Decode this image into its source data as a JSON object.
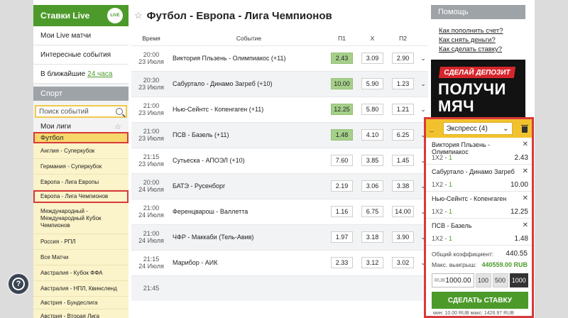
{
  "sidebar": {
    "live_title": "Ставки Live",
    "live_logo_text": "LIVE",
    "links": [
      "Мои Live матчи",
      "Интересные события"
    ],
    "soon_prefix": "В ближайшие",
    "soon_link": "24 часа",
    "sport_title": "Спорт",
    "search_placeholder": "Поиск событий",
    "my_leagues": "Мои лиги",
    "football": "Футбол",
    "leagues": [
      "Англия - Суперкубок",
      "Германия - Суперкубок",
      "Европа - Лига Европы",
      "Европа - Лига Чемпионов",
      "Международный - Международный Кубок Чемпионов",
      "Россия - РПЛ",
      "Все Матчи",
      "Австралия - Кубок ФФА",
      "Австралия - НПЛ, Квинсленд",
      "Австрия - Бундеслига",
      "Австрия - Вторая Лига"
    ]
  },
  "main": {
    "title": "Футбол - Европа - Лига Чемпионов",
    "columns": {
      "time": "Время",
      "event": "Событие",
      "p1": "П1",
      "x": "X",
      "p2": "П2"
    },
    "events": [
      {
        "time": "20:00",
        "date": "23 Июля",
        "name": "Виктория Пльзень - Олимпиакос (+11)",
        "p1": "2.43",
        "x": "3.09",
        "p2": "2.90",
        "sel": "p1"
      },
      {
        "time": "20:30",
        "date": "23 Июля",
        "name": "Сабуртало - Динамо Загреб (+10)",
        "p1": "10.00",
        "x": "5.90",
        "p2": "1.23",
        "sel": "p1"
      },
      {
        "time": "21:00",
        "date": "23 Июля",
        "name": "Нью-Сейнтс - Копенгаген (+11)",
        "p1": "12.25",
        "x": "5.80",
        "p2": "1.21",
        "sel": "p1"
      },
      {
        "time": "21:00",
        "date": "23 Июля",
        "name": "ПСВ - Базель (+11)",
        "p1": "1.48",
        "x": "4.10",
        "p2": "6.25",
        "sel": "p1"
      },
      {
        "time": "21:15",
        "date": "23 Июля",
        "name": "Сутьеска - АПОЭЛ (+10)",
        "p1": "7.60",
        "x": "3.85",
        "p2": "1.45",
        "sel": ""
      },
      {
        "time": "20:00",
        "date": "24 Июля",
        "name": "БАТЭ - Русенборг",
        "p1": "2.19",
        "x": "3.06",
        "p2": "3.38",
        "sel": ""
      },
      {
        "time": "21:00",
        "date": "24 Июля",
        "name": "Ференцварош - Валлетта",
        "p1": "1.16",
        "x": "6.75",
        "p2": "14.00",
        "sel": ""
      },
      {
        "time": "21:00",
        "date": "24 Июля",
        "name": "ЧФР - Маккаби (Тель-Авив)",
        "p1": "1.97",
        "x": "3.18",
        "p2": "3.90",
        "sel": ""
      },
      {
        "time": "21:15",
        "date": "24 Июля",
        "name": "Марибор - АИК",
        "p1": "2.33",
        "x": "3.12",
        "p2": "3.02",
        "sel": ""
      },
      {
        "time": "21:45",
        "date": "",
        "name": "",
        "p1": "",
        "x": "",
        "p2": "",
        "sel": ""
      }
    ]
  },
  "help": {
    "title": "Помощь",
    "links": [
      "Как пополнить счет?",
      "Как снять деньги?",
      "Как сделать ставку?"
    ]
  },
  "banner": {
    "band": "СДЕЛАЙ ДЕПОЗИТ",
    "line1": "ПОЛУЧИ",
    "line2": "МЯЧ"
  },
  "coupon": {
    "minimize": "_",
    "type": "Экспресс (4)",
    "bets": [
      {
        "name": "Виктория Пльзень - Олимпиакос",
        "mark_prefix": "1X2 - ",
        "mark": "1",
        "odd": "2.43"
      },
      {
        "name": "Сабуртало - Динамо Загреб",
        "mark_prefix": "1X2 - ",
        "mark": "1",
        "odd": "10.00"
      },
      {
        "name": "Нью-Сейнтс - Копенгаген",
        "mark_prefix": "1X2 - ",
        "mark": "1",
        "odd": "12.25"
      },
      {
        "name": "ПСВ - Базель",
        "mark_prefix": "1X2 - ",
        "mark": "1",
        "odd": "1.48"
      }
    ],
    "total_label": "Общий коэффициент:",
    "total_value": "440.55",
    "win_label": "Макс. выигрыш:",
    "win_value": "440559.00 RUB",
    "currency": "RUB",
    "stake": "1000.00",
    "quick": [
      "100",
      "500",
      "1000"
    ],
    "place_label": "СДЕЛАТЬ СТАВКУ",
    "limits": "мин: 10.00 RUB макс: 1426.97 RUB"
  },
  "fab": {
    "label": "?"
  }
}
